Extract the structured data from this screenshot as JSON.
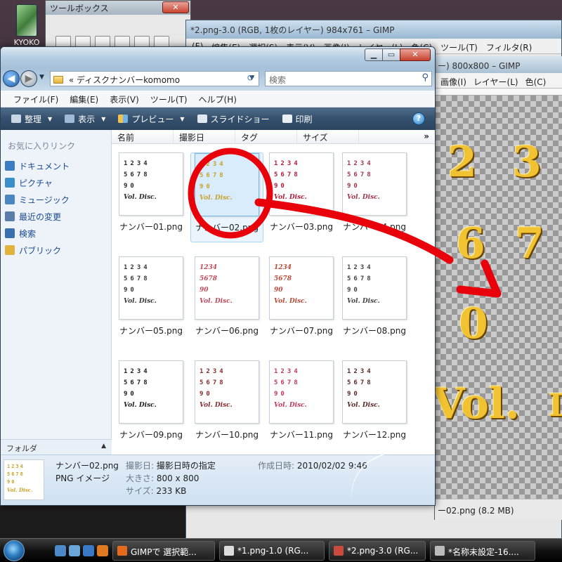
{
  "desktop": {
    "icon_label": "KYOKO"
  },
  "toolbox": {
    "title": "ツールボックス",
    "close_label": "✕"
  },
  "gimp1": {
    "title": "*2.png-3.0 (RGB, 1枚のレイヤー) 984x761 – GIMP",
    "menu": [
      "(F)",
      "編集(E)",
      "選択(S)",
      "表示(V)",
      "画像(I)",
      "レイヤー(L)",
      "色(C)",
      "ツール(T)",
      "フィルタ(R)"
    ]
  },
  "gimp2": {
    "title": "ー) 800x800 – GIMP",
    "menu": [
      "画像(I)",
      "レイヤー(L)",
      "色(C)"
    ],
    "canvas_glyphs": [
      "2",
      "3",
      "6",
      "7",
      "0",
      "Vol.",
      "D"
    ],
    "status": "ー02.png (8.2 MB)"
  },
  "explorer": {
    "address": "ディスクナンバーkomomo",
    "address_prefix": "«",
    "search_placeholder": "検索",
    "menu": [
      "ファイル(F)",
      "編集(E)",
      "表示(V)",
      "ツール(T)",
      "ヘルプ(H)"
    ],
    "toolbar": {
      "organize": "整理",
      "view": "表示",
      "preview": "プレビュー",
      "slideshow": "スライドショー",
      "print": "印刷",
      "help": "?"
    },
    "nav": {
      "favorites_header": "お気に入りリンク",
      "items": [
        {
          "label": "ドキュメント",
          "color": "#3b7cc2"
        },
        {
          "label": "ピクチャ",
          "color": "#3d8fc9"
        },
        {
          "label": "ミュージック",
          "color": "#4a86c0"
        },
        {
          "label": "最近の変更",
          "color": "#5a7ea8"
        },
        {
          "label": "検索",
          "color": "#3a6fb0"
        },
        {
          "label": "パブリック",
          "color": "#e0b43c"
        }
      ],
      "folders_label": "フォルダ"
    },
    "columns": [
      "名前",
      "撮影日",
      "タグ",
      "サイズ"
    ],
    "files": [
      {
        "name": "ナンバー01.png",
        "color": "#2b2b2b",
        "script": false,
        "selected": false
      },
      {
        "name": "ナンバー02.png",
        "color": "#c9a22a",
        "script": false,
        "selected": true
      },
      {
        "name": "ナンバー03.png",
        "color": "#b0203a",
        "script": false,
        "selected": false
      },
      {
        "name": "ナンバー04.png",
        "color": "#a0384c",
        "script": false,
        "selected": false
      },
      {
        "name": "ナンバー05.png",
        "color": "#3a3a3a",
        "script": false,
        "selected": false
      },
      {
        "name": "ナンバー06.png",
        "color": "#c24a5a",
        "script": true,
        "selected": false
      },
      {
        "name": "ナンバー07.png",
        "color": "#b84a3a",
        "script": true,
        "selected": false
      },
      {
        "name": "ナンバー08.png",
        "color": "#444444",
        "script": false,
        "selected": false
      },
      {
        "name": "ナンバー09.png",
        "color": "#1e1e1e",
        "script": false,
        "selected": false
      },
      {
        "name": "ナンバー10.png",
        "color": "#8a2c2c",
        "script": false,
        "selected": false
      },
      {
        "name": "ナンバー11.png",
        "color": "#c23a5c",
        "script": false,
        "selected": false
      },
      {
        "name": "ナンバー12.png",
        "color": "#5a2a2a",
        "script": false,
        "selected": false
      }
    ],
    "thumb_text": {
      "row1": "1234",
      "row2": "5678",
      "row3": "90",
      "row4": "Vol. Disc."
    },
    "details": {
      "file_name": "ナンバー02.png",
      "file_type": "PNG イメージ",
      "date_taken_label": "撮影日:",
      "date_taken_value": "撮影日時の指定",
      "created_label": "作成日時:",
      "created_value": "2010/02/02 9:46",
      "dimensions_label": "大きさ:",
      "dimensions_value": "800 x 800",
      "size_label": "サイズ:",
      "size_value": "233 KB"
    }
  },
  "taskbar": {
    "buttons": [
      {
        "label": "GIMPで 選択範...",
        "color": "#e46a1e"
      },
      {
        "label": "*1.png-1.0 (RG...",
        "color": "#ddd"
      },
      {
        "label": "*2.png-3.0 (RG...",
        "color": "#c94b3b"
      },
      {
        "label": "*名称未設定-16....",
        "color": "#bbb"
      }
    ]
  },
  "colors": {
    "annotation_red": "#e8000a",
    "toolbar_bg": "#35506c",
    "selection": "#d8ecfb"
  }
}
